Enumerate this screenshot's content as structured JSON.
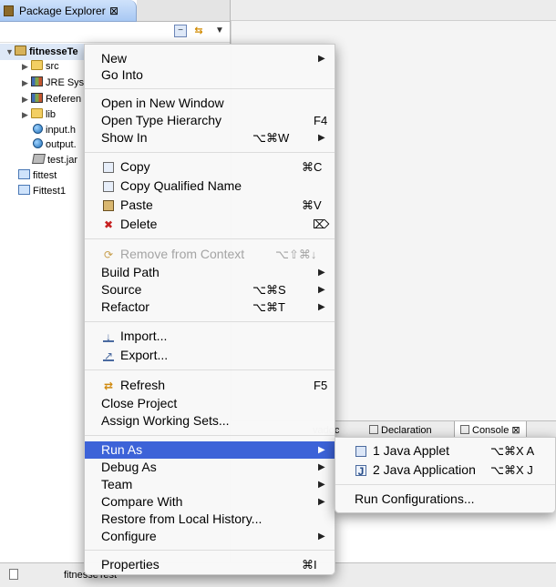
{
  "package_explorer": {
    "tab_label": "Package Explorer",
    "close_glyph": "⊠",
    "toolbar_icons": [
      "collapse-all-icon",
      "link-with-editor-icon",
      "view-menu-icon"
    ],
    "tree": [
      {
        "label": "fitnesseTe",
        "icon": "project-icon",
        "expanded": true
      },
      {
        "label": "src",
        "icon": "source-folder-icon"
      },
      {
        "label": "JRE Sys",
        "icon": "library-icon"
      },
      {
        "label": "Referen",
        "icon": "library-icon"
      },
      {
        "label": "lib",
        "icon": "folder-icon"
      },
      {
        "label": "input.h",
        "icon": "html-file-icon"
      },
      {
        "label": "output.",
        "icon": "html-file-icon"
      },
      {
        "label": "test.jar",
        "icon": "jar-icon"
      },
      {
        "label": "fittest",
        "icon": "project-icon"
      },
      {
        "label": "Fittest1",
        "icon": "project-icon"
      }
    ]
  },
  "bottom_tabs": [
    {
      "label": "vadoc"
    },
    {
      "label": "Declaration"
    },
    {
      "label": "Console",
      "close_glyph": "⊠"
    }
  ],
  "status_bar": {
    "text": "fitnesseTest"
  },
  "context_menu": {
    "items": [
      {
        "label": "New",
        "submenu": true
      },
      {
        "label": "Go Into"
      },
      {
        "label": "Open in New Window"
      },
      {
        "label": "Open Type Hierarchy",
        "shortcut": "F4"
      },
      {
        "label": "Show In",
        "shortcut": "⌥⌘W",
        "submenu": true
      },
      {
        "label": "Copy",
        "shortcut": "⌘C",
        "icon": "copy-icon"
      },
      {
        "label": "Copy Qualified Name",
        "icon": "copy-icon"
      },
      {
        "label": "Paste",
        "shortcut": "⌘V",
        "icon": "paste-icon"
      },
      {
        "label": "Delete",
        "shortcut": "⌦",
        "icon": "delete-icon"
      },
      {
        "label": "Remove from Context",
        "shortcut": "⌥⇧⌘↓",
        "icon": "remove-icon",
        "disabled": true
      },
      {
        "label": "Build Path",
        "submenu": true
      },
      {
        "label": "Source",
        "shortcut": "⌥⌘S",
        "submenu": true
      },
      {
        "label": "Refactor",
        "shortcut": "⌥⌘T",
        "submenu": true
      },
      {
        "label": "Import...",
        "icon": "import-icon"
      },
      {
        "label": "Export...",
        "icon": "export-icon"
      },
      {
        "label": "Refresh",
        "shortcut": "F5",
        "icon": "refresh-icon"
      },
      {
        "label": "Close Project"
      },
      {
        "label": "Assign Working Sets..."
      },
      {
        "label": "Run As",
        "submenu": true,
        "selected": true
      },
      {
        "label": "Debug As",
        "submenu": true
      },
      {
        "label": "Team",
        "submenu": true
      },
      {
        "label": "Compare With",
        "submenu": true
      },
      {
        "label": "Restore from Local History..."
      },
      {
        "label": "Configure",
        "submenu": true
      },
      {
        "label": "Properties",
        "shortcut": "⌘I"
      }
    ],
    "arrow_glyph": "▶"
  },
  "run_as_submenu": {
    "items": [
      {
        "label": "1 Java Applet",
        "shortcut": "⌥⌘X A",
        "icon": "java-applet-icon"
      },
      {
        "label": "2 Java Application",
        "shortcut": "⌥⌘X J",
        "icon": "java-application-icon"
      },
      {
        "label": "Run Configurations..."
      }
    ]
  },
  "colors": {
    "selection": "#3d63d8",
    "tab_active": "#a8c8f3"
  }
}
